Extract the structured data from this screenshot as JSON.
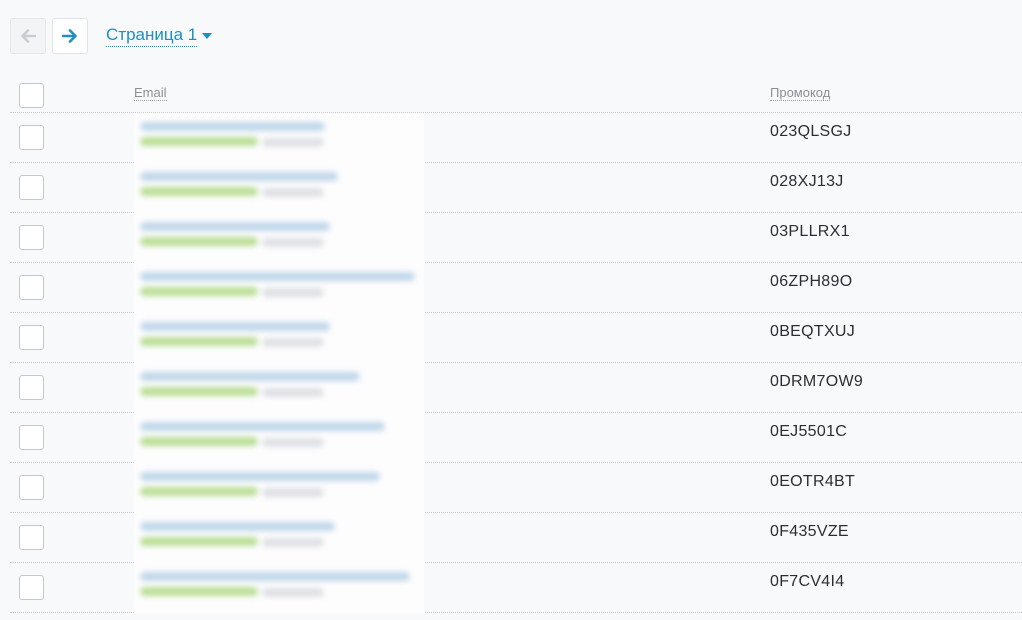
{
  "pager": {
    "prev_icon": "arrow-left-icon",
    "next_icon": "arrow-right-icon",
    "page_label": "Страница 1",
    "dropdown_icon": "caret-down-icon"
  },
  "table": {
    "headers": {
      "email": "Email",
      "promo": "Промокод"
    },
    "rows": [
      {
        "promo": "023QLSGJ"
      },
      {
        "promo": "028XJ13J"
      },
      {
        "promo": "03PLLRX1"
      },
      {
        "promo": "06ZPH89O"
      },
      {
        "promo": "0BEQTXUJ"
      },
      {
        "promo": "0DRM7OW9"
      },
      {
        "promo": "0EJ5501C"
      },
      {
        "promo": "0EOTR4BT"
      },
      {
        "promo": "0F435VZE"
      },
      {
        "promo": "0F7CV4I4"
      }
    ]
  },
  "colors": {
    "accent": "#1f8fbf",
    "status_green": "#9fd16a",
    "email_link_blue": "#8fb8d8"
  }
}
